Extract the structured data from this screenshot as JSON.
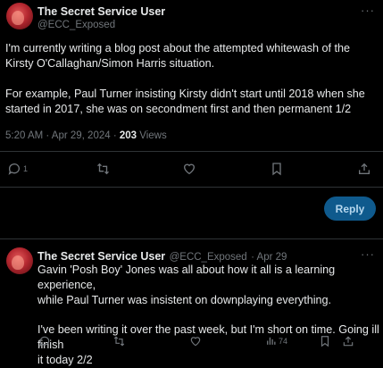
{
  "tweet": {
    "author_name": "The Secret Service User",
    "author_handle": "@ECC_Exposed",
    "text_line1": "I'm currently writing a blog post about the attempted whitewash of the",
    "text_line2": "Kirsty O'Callaghan/Simon Harris situation.",
    "text_line3": "For example, Paul Turner insisting Kirsty didn't start until 2018 when she",
    "text_line4": "started in 2017, she was on secondment first and then permanent 1/2",
    "timestamp": "5:20 AM · Apr 29, 2024 · ",
    "views_count": "203",
    "views_label": "Views",
    "reply_count": "1"
  },
  "reply_composer": {
    "button_label": "Reply"
  },
  "reply": {
    "author_name": "The Secret Service User",
    "author_handle": "@ECC_Exposed",
    "date": "· Apr 29",
    "text_line1": "Gavin 'Posh Boy' Jones was all about how it all is a learning experience,",
    "text_line2": "while Paul Turner was insistent on downplaying everything.",
    "text_line3": "I've been writing it over the past week, but I'm short on time. Going ill finish",
    "text_line4": "it today 2/2",
    "views_count": "74"
  },
  "icons": {
    "more": "more-horizontal-icon",
    "reply": "speech-bubble-icon",
    "retweet": "retweet-arrows-icon",
    "like": "heart-icon",
    "bookmark": "bookmark-icon",
    "share": "share-upload-icon",
    "views": "bar-chart-icon"
  },
  "colors": {
    "background": "#000000",
    "text": "#e7e9ea",
    "muted": "#71767b",
    "reply_button": "#0f5a8d"
  }
}
